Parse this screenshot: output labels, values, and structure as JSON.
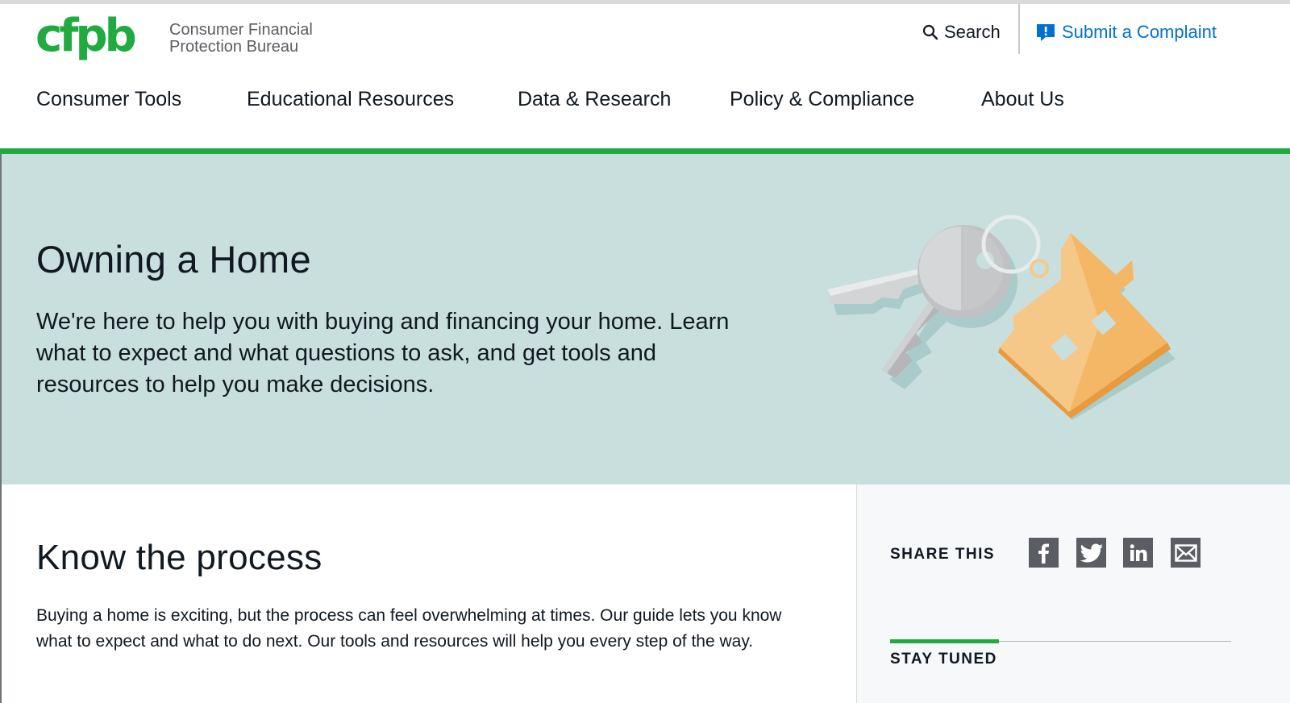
{
  "brand": {
    "logo_letters": "cfpb",
    "name_line1": "Consumer Financial",
    "name_line2": "Protection Bureau",
    "green": "#20aa3f",
    "light_green": "#addc91"
  },
  "header": {
    "search_label": "Search",
    "complaint_label": "Submit a Complaint"
  },
  "nav": {
    "items": [
      {
        "label": "Consumer Tools"
      },
      {
        "label": "Educational Resources"
      },
      {
        "label": "Data & Research"
      },
      {
        "label": "Policy & Compliance"
      },
      {
        "label": "About Us"
      }
    ]
  },
  "hero": {
    "title": "Owning a Home",
    "description": "We're here to help you with buying and financing your home. Learn what to expect and what questions to ask, and get tools and resources to help you make decisions.",
    "background": "#c9dfdd"
  },
  "main": {
    "heading": "Know the process",
    "body": "Buying a home is exciting, but the process can feel overwhelming at times. Our guide lets you know what to expect and what to do next. Our tools and resources will help you every step of the way."
  },
  "sidebar": {
    "share_label": "SHARE THIS",
    "share_icons": [
      "facebook-icon",
      "twitter-icon",
      "linkedin-icon",
      "email-icon"
    ],
    "stay_tuned_label": "STAY TUNED"
  }
}
